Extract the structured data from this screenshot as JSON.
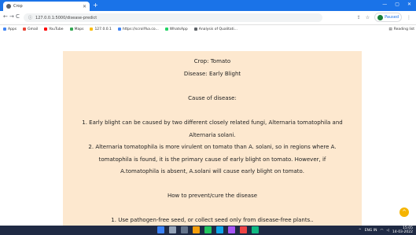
{
  "browser": {
    "tab_title": "Crop",
    "address": "127.0.0.1:5000/disease-predict",
    "profile_label": "Paused",
    "reading_list_label": "Reading list"
  },
  "bookmarks": [
    {
      "label": "Apps",
      "color": "#4285f4"
    },
    {
      "label": "Gmail",
      "color": "#ea4335"
    },
    {
      "label": "YouTube",
      "color": "#ff0000"
    },
    {
      "label": "Maps",
      "color": "#34a853"
    },
    {
      "label": "127.0.0.1",
      "color": "#fbbc05"
    },
    {
      "label": "https://scroll%a.co...",
      "color": "#4285f4"
    },
    {
      "label": "WhatsApp",
      "color": "#25d366"
    },
    {
      "label": "Analysis of Qualitati...",
      "color": "#5f6368"
    }
  ],
  "content": {
    "crop_line": "Crop: Tomato",
    "disease_line": "Disease: Early Blight",
    "cause_heading": "Cause of disease:",
    "cause_1a": "1. Early blight can be caused by two different closely related fungi, Alternaria tomatophila and",
    "cause_1b": "Alternaria solani.",
    "cause_2a": "2. Alternaria tomatophila is more virulent on tomato than A. solani, so in regions where A.",
    "cause_2b": "tomatophila is found, it is the primary cause of early blight on tomato. However, if",
    "cause_2c": "A.tomatophila is absent, A.solani will cause early blight on tomato.",
    "prevent_heading": "How to prevent/cure the disease",
    "prevent_1": "1. Use pathogen-free seed, or collect seed only from disease-free plants.."
  },
  "taskbar": {
    "lang": "ENG IN",
    "time": "15:05",
    "date": "14-03-2022"
  }
}
